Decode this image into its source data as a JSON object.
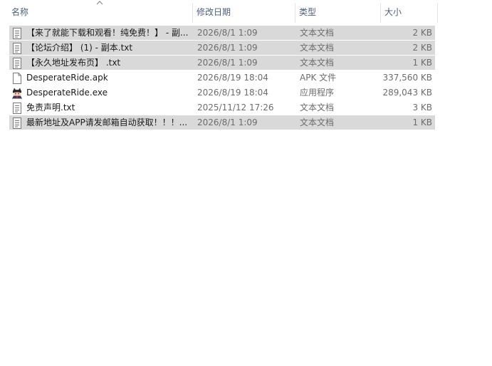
{
  "columns": {
    "name": "名称",
    "date": "修改日期",
    "type": "类型",
    "size": "大小"
  },
  "files": [
    {
      "name": "【来了就能下载和观看！纯免费！】 - 副...",
      "date": "2026/8/1 1:09",
      "type": "文本文档",
      "size": "2 KB",
      "icon": "text-document-icon",
      "selected": true
    },
    {
      "name": "【论坛介绍】 (1) - 副本.txt",
      "date": "2026/8/1 1:09",
      "type": "文本文档",
      "size": "2 KB",
      "icon": "text-document-icon",
      "selected": true
    },
    {
      "name": "【永久地址发布页】 .txt",
      "date": "2026/8/1 1:09",
      "type": "文本文档",
      "size": "1 KB",
      "icon": "text-document-icon",
      "selected": true
    },
    {
      "name": "DesperateRide.apk",
      "date": "2026/8/19 18:04",
      "type": "APK 文件",
      "size": "337,560 KB",
      "icon": "blank-file-icon",
      "selected": false
    },
    {
      "name": "DesperateRide.exe",
      "date": "2026/8/19 18:04",
      "type": "应用程序",
      "size": "289,043 KB",
      "icon": "app-character-icon",
      "selected": false
    },
    {
      "name": "免责声明.txt",
      "date": "2025/11/12 17:26",
      "type": "文本文档",
      "size": "3 KB",
      "icon": "text-document-icon",
      "selected": false
    },
    {
      "name": "最新地址及APP请发邮箱自动获取！！！...",
      "date": "2026/8/1 1:09",
      "type": "文本文档",
      "size": "1 KB",
      "icon": "text-document-icon",
      "selected": true
    }
  ]
}
